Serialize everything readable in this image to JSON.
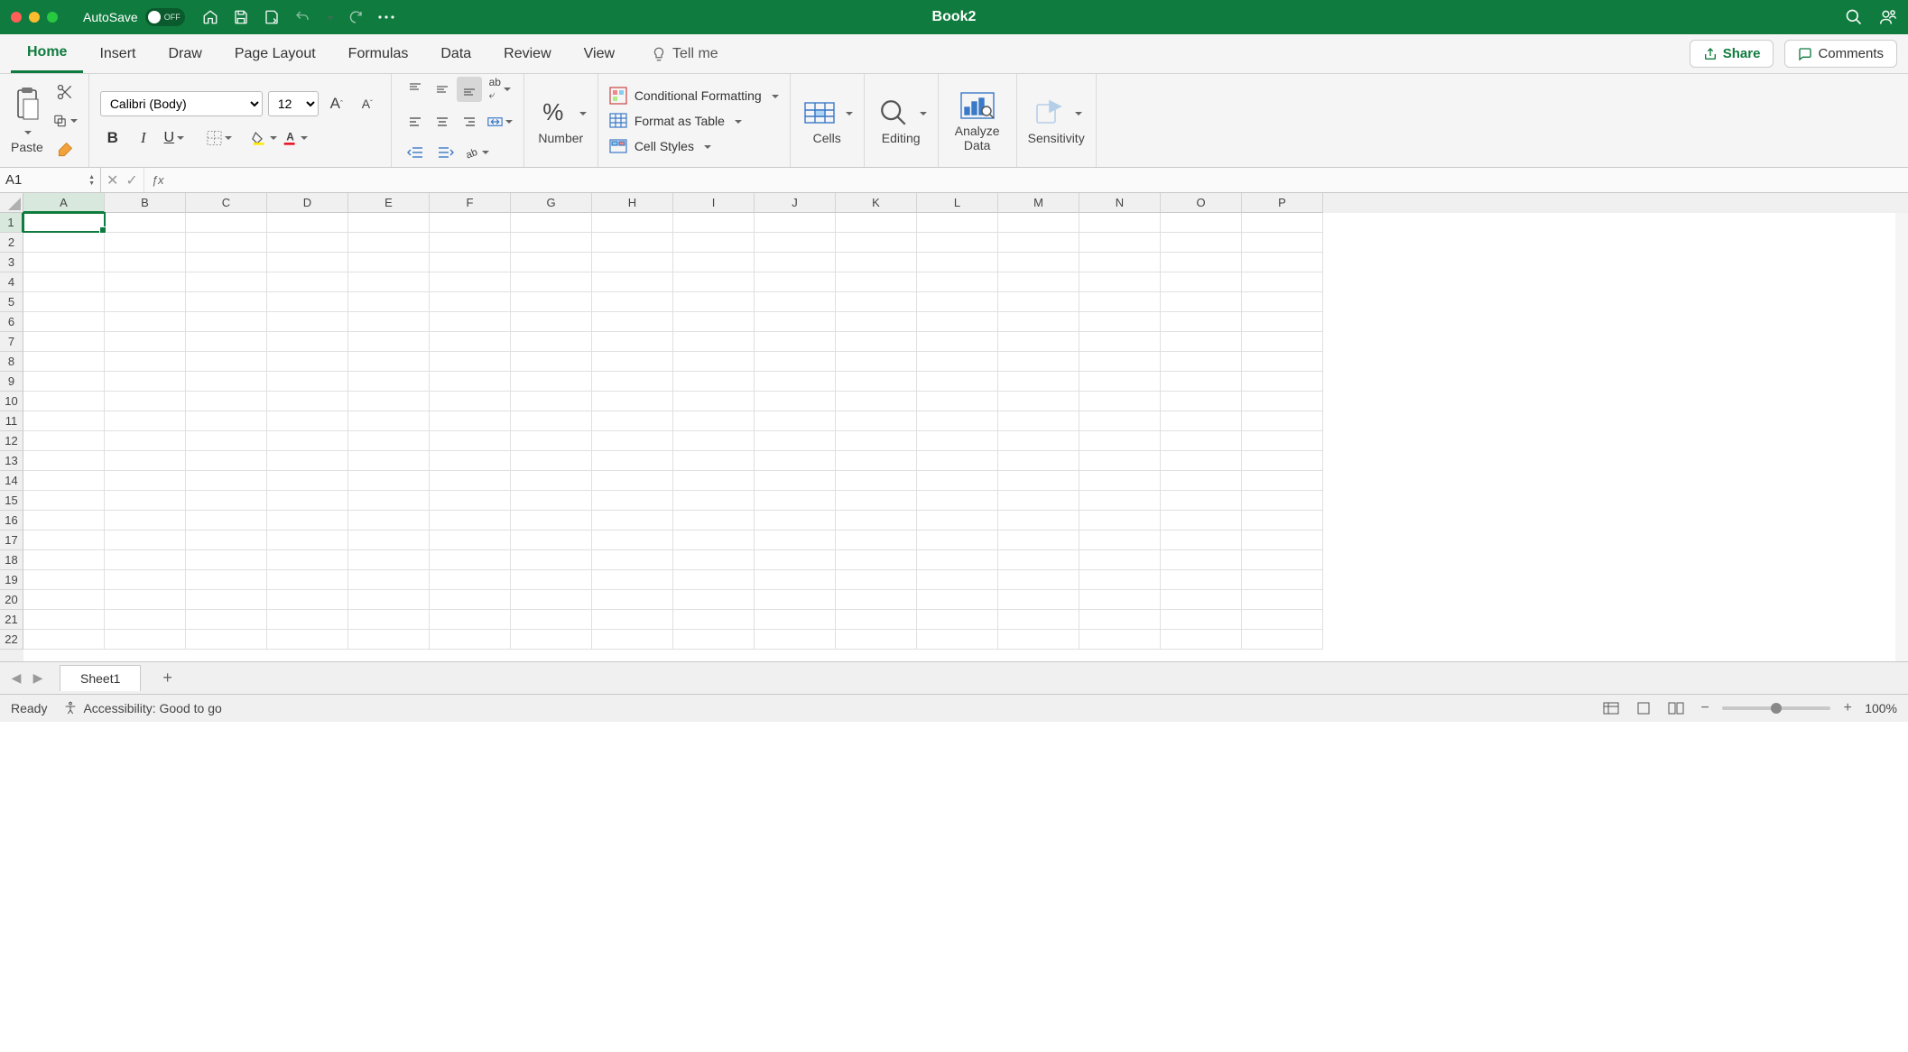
{
  "title": "Book2",
  "autosave": {
    "label": "AutoSave",
    "state": "OFF"
  },
  "tabs": [
    "Home",
    "Insert",
    "Draw",
    "Page Layout",
    "Formulas",
    "Data",
    "Review",
    "View"
  ],
  "active_tab": "Home",
  "tellme": "Tell me",
  "share": "Share",
  "comments": "Comments",
  "ribbon": {
    "paste": "Paste",
    "font_name": "Calibri (Body)",
    "font_size": "12",
    "number": "Number",
    "cond_fmt": "Conditional Formatting",
    "fmt_table": "Format as Table",
    "cell_styles": "Cell Styles",
    "cells": "Cells",
    "editing": "Editing",
    "analyze": "Analyze Data",
    "sensitivity": "Sensitivity"
  },
  "namebox": "A1",
  "columns": [
    "A",
    "B",
    "C",
    "D",
    "E",
    "F",
    "G",
    "H",
    "I",
    "J",
    "K",
    "L",
    "M",
    "N",
    "O",
    "P"
  ],
  "rows": 22,
  "selected_cell": {
    "col": "A",
    "row": 1
  },
  "sheet": "Sheet1",
  "status": {
    "ready": "Ready",
    "accessibility": "Accessibility: Good to go",
    "zoom": "100%"
  }
}
